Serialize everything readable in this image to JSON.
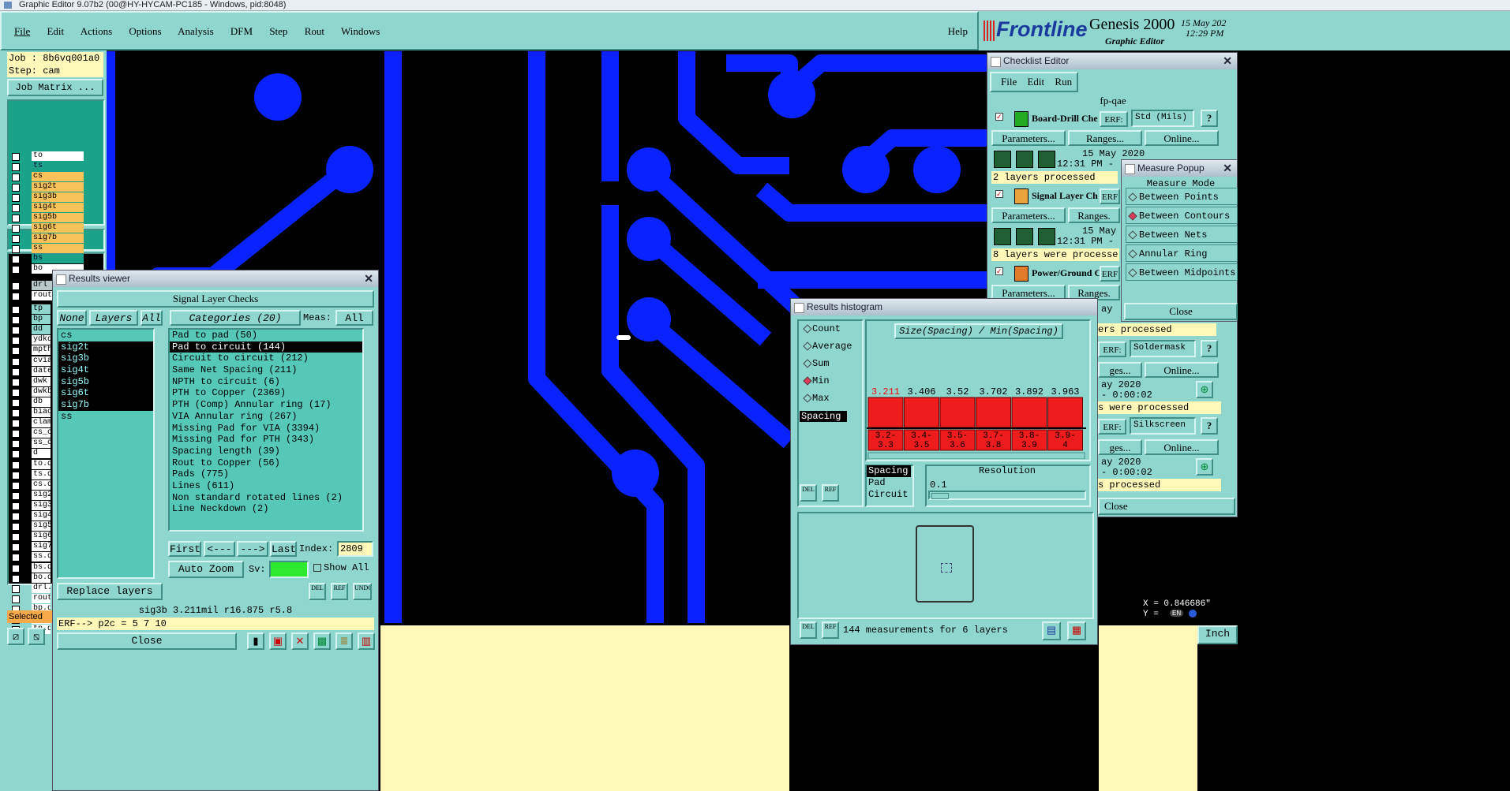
{
  "window_title": "Graphic Editor 9.07b2 (00@HY-HYCAM-PC185 - Windows, pid:8048)",
  "menubar": {
    "items": [
      "File",
      "Edit",
      "Actions",
      "Options",
      "Analysis",
      "DFM",
      "Step",
      "Rout",
      "Windows"
    ],
    "help": "Help"
  },
  "brand": {
    "logo": "Frontline",
    "product": "Genesis 2000",
    "subtitle": "Graphic Editor",
    "date": "15 May 202",
    "time": "12:29 PM"
  },
  "left_panel": {
    "job": "Job : 8b6vq001a0",
    "step": "Step: cam",
    "job_matrix": "Job Matrix ...",
    "layers_group1": [
      "to",
      "ts",
      "cs",
      "sig2t",
      "sig3b",
      "sig4t",
      "sig5b",
      "sig6t",
      "sig7b",
      "ss",
      "bs",
      "bo"
    ],
    "layers_group2": [
      "drl",
      "rout"
    ],
    "layers_group3": [
      "tp",
      "bp",
      "dd",
      "ydkd",
      "mpth",
      "cvia",
      "date",
      "dwk",
      "dwkb",
      "db",
      "biao",
      "clam",
      "cs_c",
      "ss_c",
      "d",
      "to.d",
      "ts.d",
      "cs.d",
      "sig2",
      "sig3",
      "sig4",
      "sig5",
      "sig6",
      "sig7",
      "ss.d",
      "bs.d",
      "bo.d",
      "drl.",
      "rout",
      "bp.d",
      "dd.d",
      "tp.d"
    ],
    "selected_label": "Selected"
  },
  "results_viewer": {
    "title": "Results viewer",
    "header": "Signal Layer Checks",
    "none_btn": "None",
    "layers_btn": "Layers",
    "all_btn": "All",
    "categories_btn": "Categories (20)",
    "meas_label": "Meas:",
    "meas_value": "All",
    "layers": [
      "cs",
      "sig2t",
      "sig3b",
      "sig4t",
      "sig5b",
      "sig6t",
      "sig7b",
      "ss"
    ],
    "categories": [
      "Pad to pad (50)",
      "Pad to circuit (144)",
      "Circuit to circuit (212)",
      "Same Net Spacing (211)",
      "NPTH to circuit (6)",
      "PTH to Copper (2369)",
      "PTH (Comp) Annular ring (17)",
      "VIA Annular ring (267)",
      "Missing Pad for VIA (3394)",
      "Missing Pad for PTH (343)",
      "Spacing length (39)",
      "Rout to Copper (56)",
      "Pads (775)",
      "Lines (611)",
      "Non standard rotated lines (2)",
      "Line Neckdown (2)"
    ],
    "first": "First",
    "prev": "<---",
    "next": "--->",
    "last": "Last",
    "index_label": "Index:",
    "index_value": "2809",
    "auto_zoom": "Auto Zoom",
    "sv_label": "Sv:",
    "show_all": "Show All",
    "replace_layers": "Replace layers",
    "del": "DEL",
    "ref": "REF",
    "undo": "UNDO",
    "status": "sig3b 3.211mil  r16.875  r5.8",
    "erf": "ERF--> p2c = 5 7 10",
    "close": "Close"
  },
  "checklist_editor": {
    "title": "Checklist Editor",
    "menu": [
      "File",
      "Edit",
      "Run"
    ],
    "name": "fp-qae",
    "checks": [
      {
        "name": "Board-Drill Che",
        "erf": "ERF:",
        "erf_value": "Std (Mils)",
        "params": "Parameters...",
        "ranges": "Ranges...",
        "online": "Online...",
        "date": "15 May 2020",
        "time": "12:31 PM -",
        "status": "2 layers processed"
      },
      {
        "name": "Signal Layer Ch",
        "erf": "ERF",
        "params": "Parameters...",
        "ranges": "Ranges.",
        "date": "15 May",
        "time": "12:31 PM -",
        "status": "8 layers were processe"
      },
      {
        "name": "Power/Ground C",
        "erf": "ERF",
        "params": "Parameters...",
        "ranges": "Ranges."
      }
    ],
    "frag": {
      "lay": "ay",
      "processed1": "ers processed",
      "erf_a": "ERF:",
      "soldermask": "Soldermask",
      "ges1": "ges...",
      "online1": "Online...",
      "date1": "ay 2020",
      "time1": "- 0:00:02",
      "status2": "s were processed",
      "erf_b": "ERF:",
      "silkscreen": "Silkscreen",
      "ges2": "ges...",
      "online2": "Online...",
      "date2": "ay 2020",
      "time2": "- 0:00:02",
      "status3": "s processed",
      "close": "Close"
    }
  },
  "measure_popup": {
    "title": "Measure Popup",
    "heading": "Measure Mode",
    "options": [
      "Between Points",
      "Between Contours",
      "Between Nets",
      "Annular Ring",
      "Between Midpoints"
    ],
    "selected": "Between Contours",
    "close": "Close"
  },
  "results_histogram": {
    "title": "Results histogram",
    "stats": [
      "Count",
      "Average",
      "Sum",
      "Min",
      "Max"
    ],
    "selected_stat": "Min",
    "spacing_tab": "Spacing",
    "chart_title": "Size(Spacing) / Min(Spacing)",
    "bars": [
      {
        "label": "3.211",
        "range": "3.2-3.3",
        "value": 0.0
      },
      {
        "label": "3.406",
        "range": "3.4-3.5",
        "value": 0.0
      },
      {
        "label": "3.52",
        "range": "3.5-3.6",
        "value": 0.0
      },
      {
        "label": "3.702",
        "range": "3.7-3.8",
        "value": 0.0
      },
      {
        "label": "3.892",
        "range": "3.8-3.9",
        "value": 0.0
      },
      {
        "label": "3.963",
        "range": "3.9-4",
        "value": 0.0
      }
    ],
    "types": [
      "Spacing",
      "Pad",
      "Circuit"
    ],
    "resolution_label": "Resolution",
    "resolution_value": "0.1",
    "del": "DEL",
    "ref": "REF",
    "footer": "144 measurements for 6 layers"
  },
  "coords": {
    "x": "X = 0.846686\"",
    "y": "Y = ",
    "lang": "EN"
  },
  "units": "Inch",
  "chart_data": {
    "type": "bar",
    "title": "Size(Spacing) / Min(Spacing)",
    "categories": [
      "3.2-3.3",
      "3.4-3.5",
      "3.5-3.6",
      "3.7-3.8",
      "3.8-3.9",
      "3.9-4"
    ],
    "values": [
      3.211,
      3.406,
      3.52,
      3.702,
      3.892,
      3.963
    ],
    "xlabel": "",
    "ylabel": ""
  }
}
